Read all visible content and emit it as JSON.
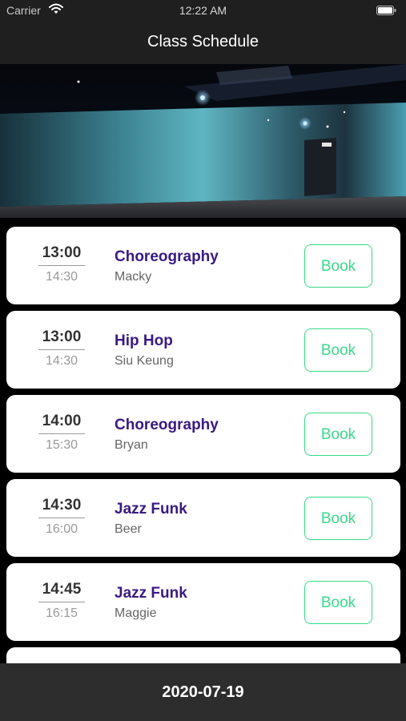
{
  "status_bar": {
    "carrier": "Carrier",
    "time": "12:22 AM"
  },
  "nav": {
    "title": "Class Schedule"
  },
  "schedule": [
    {
      "start": "13:00",
      "end": "14:30",
      "class_name": "Choreography",
      "instructor": "Macky",
      "action": "Book"
    },
    {
      "start": "13:00",
      "end": "14:30",
      "class_name": "Hip Hop",
      "instructor": "Siu Keung",
      "action": "Book"
    },
    {
      "start": "14:00",
      "end": "15:30",
      "class_name": "Choreography",
      "instructor": "Bryan",
      "action": "Book"
    },
    {
      "start": "14:30",
      "end": "16:00",
      "class_name": "Jazz Funk",
      "instructor": "Beer",
      "action": "Book"
    },
    {
      "start": "14:45",
      "end": "16:15",
      "class_name": "Jazz Funk",
      "instructor": "Maggie",
      "action": "Book"
    }
  ],
  "footer": {
    "date": "2020-07-19"
  },
  "colors": {
    "class_name": "#3a1a82",
    "book_accent": "#39d988",
    "bar_background": "#1f1f1f",
    "footer_background": "#2d2d2d"
  }
}
